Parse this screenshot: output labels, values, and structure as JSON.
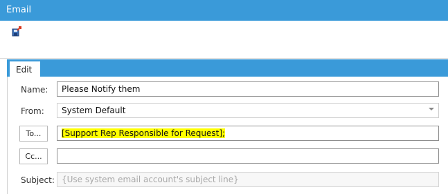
{
  "window": {
    "title": "Email"
  },
  "toolbar": {
    "save_icon": "save-icon"
  },
  "tabs": [
    {
      "label": "Edit"
    }
  ],
  "form": {
    "name": {
      "label": "Name:",
      "value": "Please Notify them"
    },
    "from": {
      "label": "From:",
      "value": "System Default"
    },
    "to": {
      "button": "To...",
      "value": "[Support Rep Responsible for Request];"
    },
    "cc": {
      "button": "Cc...",
      "value": ""
    },
    "subject": {
      "label": "Subject:",
      "placeholder": "{Use system email account's subject line}"
    }
  },
  "colors": {
    "accent": "#3a9ad9",
    "highlight": "#ffff00"
  }
}
